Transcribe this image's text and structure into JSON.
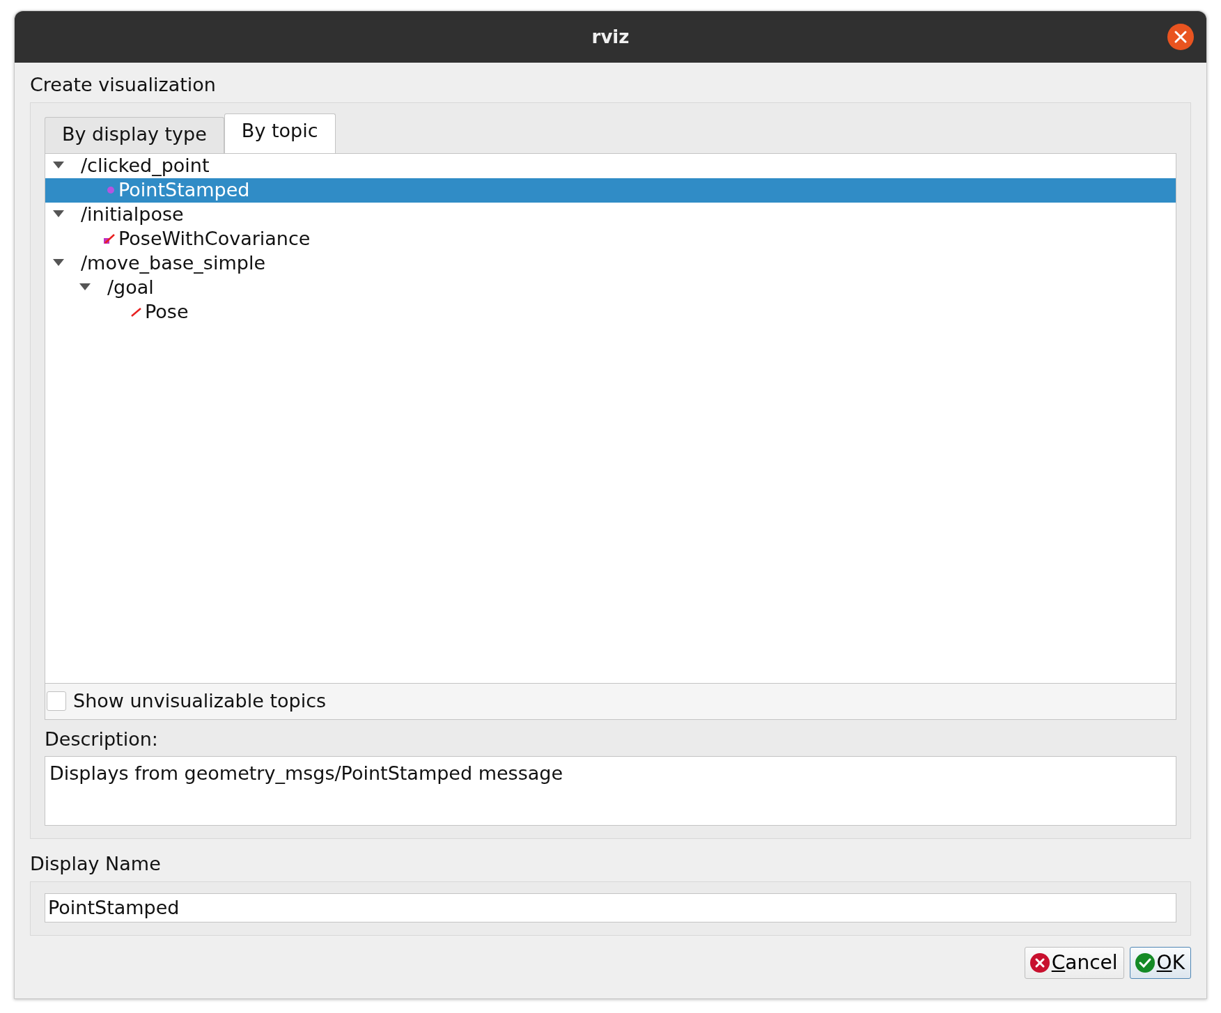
{
  "window": {
    "title": "rviz"
  },
  "heading": "Create visualization",
  "tabs": [
    {
      "label": "By display type",
      "selected": false
    },
    {
      "label": "By topic",
      "selected": true
    }
  ],
  "tree": [
    {
      "label": "/clicked_point",
      "kind": "topic",
      "expanded": true,
      "selected": false,
      "children": [
        {
          "label": "PointStamped",
          "kind": "point",
          "selected": true
        }
      ]
    },
    {
      "label": "/initialpose",
      "kind": "topic",
      "expanded": true,
      "selected": false,
      "children": [
        {
          "label": "PoseWithCovariance",
          "kind": "covariance",
          "selected": false
        }
      ]
    },
    {
      "label": "/move_base_simple",
      "kind": "topic",
      "expanded": true,
      "selected": false,
      "children": [
        {
          "label": "/goal",
          "kind": "topic",
          "expanded": true,
          "selected": false,
          "children": [
            {
              "label": "Pose",
              "kind": "pose",
              "selected": false
            }
          ]
        }
      ]
    }
  ],
  "show_unvisualizable": {
    "label": "Show unvisualizable topics",
    "checked": false
  },
  "description": {
    "label": "Description:",
    "text": "Displays from geometry_msgs/PointStamped message"
  },
  "display_name": {
    "label": "Display Name",
    "value": "PointStamped"
  },
  "buttons": [
    {
      "label": "Cancel",
      "kind": "cancel"
    },
    {
      "label": "OK",
      "kind": "ok"
    }
  ]
}
